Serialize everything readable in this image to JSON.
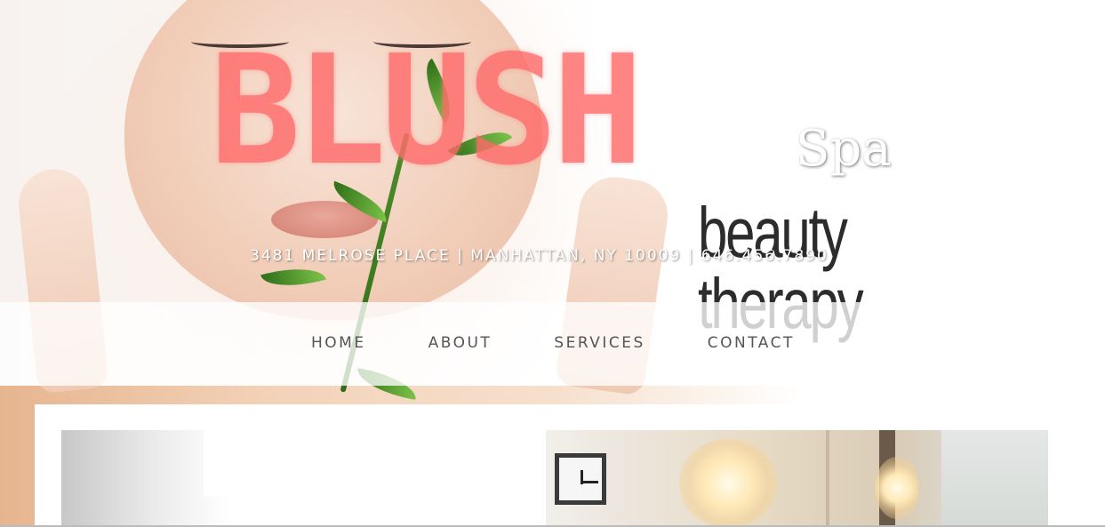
{
  "brand": {
    "title": "BLUSH",
    "spa": "Spa",
    "tagline": "beauty therapy",
    "address": "3481 MELROSE PLACE | MANHATTAN, NY 10009 | 646.456.7890"
  },
  "nav": {
    "items": [
      {
        "label": "HOME"
      },
      {
        "label": "ABOUT"
      },
      {
        "label": "SERVICES"
      },
      {
        "label": "CONTACT"
      }
    ]
  },
  "colors": {
    "brand_title": "#ff6b6b",
    "nav_text": "#555555",
    "tagline": "#2c2c2c"
  },
  "icons": {
    "clock": "clock-icon"
  }
}
